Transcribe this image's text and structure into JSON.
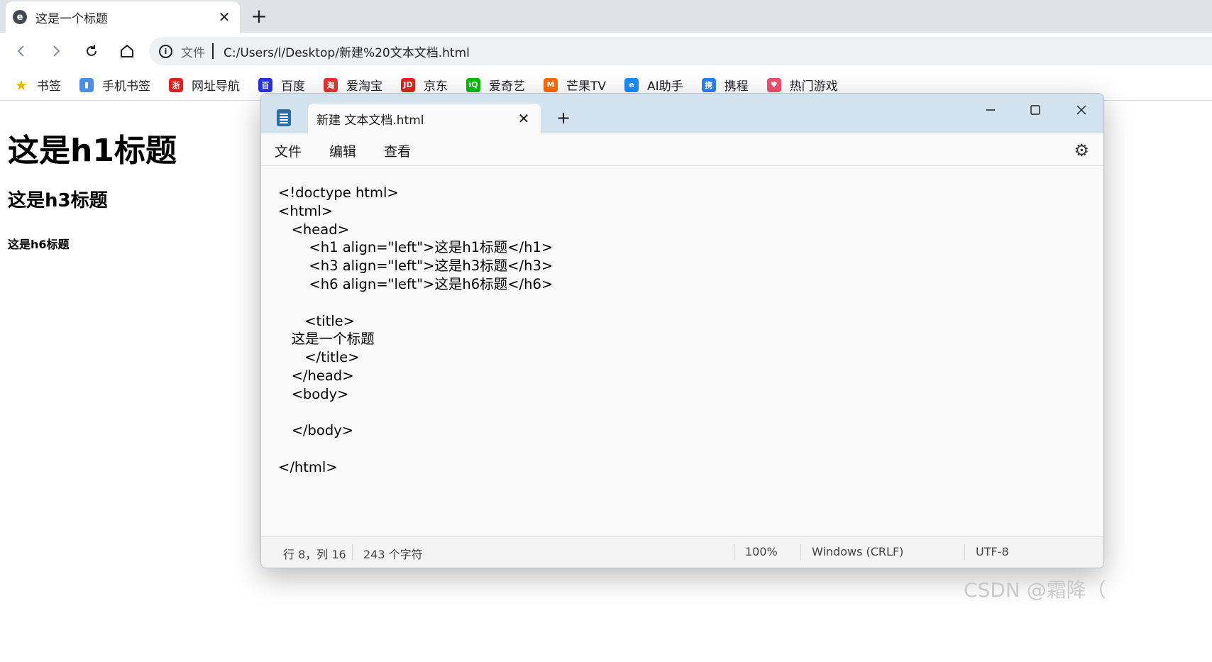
{
  "browser": {
    "tab_title": "这是一个标题",
    "url_label": "文件",
    "url": "C:/Users/l/Desktop/新建%20文本文档.html"
  },
  "bookmarks": [
    {
      "label": "书签",
      "icon": "star-icon",
      "color": "#f5b400"
    },
    {
      "label": "手机书签",
      "icon": "phone-icon",
      "color": "#4a90e2"
    },
    {
      "label": "网址导航",
      "icon": "navigation-icon",
      "color": "#e02020"
    },
    {
      "label": "百度",
      "icon": "baidu-icon",
      "color": "#2932e1"
    },
    {
      "label": "爱淘宝",
      "icon": "taobao-icon",
      "color": "#e8322e"
    },
    {
      "label": "京东",
      "icon": "jd-icon",
      "color": "#e1251b"
    },
    {
      "label": "爱奇艺",
      "icon": "iqiyi-icon",
      "color": "#00be06"
    },
    {
      "label": "芒果TV",
      "icon": "mangotv-icon",
      "color": "#ff6a00"
    },
    {
      "label": "AI助手",
      "icon": "ai-assistant-icon",
      "color": "#1a8cff"
    },
    {
      "label": "携程",
      "icon": "ctrip-icon",
      "color": "#2a7fff"
    },
    {
      "label": "热门游戏",
      "icon": "games-icon",
      "color": "#f0506e"
    }
  ],
  "page": {
    "h1": "这是h1标题",
    "h3": "这是h3标题",
    "h6": "这是h6标题"
  },
  "notepad": {
    "tab_title": "新建 文本文档.html",
    "menu": [
      "文件",
      "编辑",
      "查看"
    ],
    "code": "<!doctype html>\n<html>\n   <head>\n       <h1 align=\"left\">这是h1标题</h1>\n       <h3 align=\"left\">这是h3标题</h3>\n       <h6 align=\"left\">这是h6标题</h6>\n\n      <title>\n   这是一个标题\n      </title>\n   </head>\n   <body>\n\n   </body>\n\n</html>",
    "status": {
      "position": "行 8，列 16",
      "chars": "243 个字符",
      "zoom": "100%",
      "line_ending": "Windows (CRLF)",
      "encoding": "UTF-8"
    }
  },
  "watermark": "CSDN @霜降（"
}
